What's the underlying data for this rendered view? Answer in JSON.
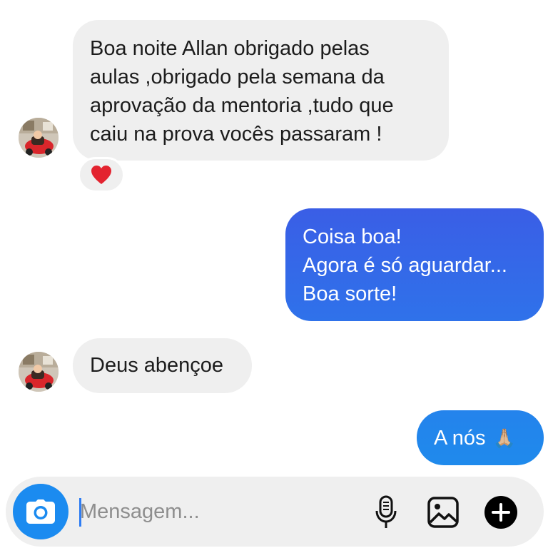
{
  "messages": [
    {
      "direction": "incoming",
      "lines": [
        "Boa noite Allan obrigado pelas",
        "aulas ,obrigado pela semana da",
        "aprovação da mentoria ,tudo que",
        "caiu na prova vocês passaram !"
      ],
      "reaction": "heart"
    },
    {
      "direction": "outgoing",
      "lines": [
        "Coisa boa!",
        "Agora é só aguardar...",
        "Boa sorte!"
      ]
    },
    {
      "direction": "incoming",
      "lines": [
        "Deus abençoe"
      ]
    },
    {
      "direction": "outgoing",
      "text": "A nós",
      "emoji": "🙏🏼"
    }
  ],
  "composer": {
    "placeholder": "Mensagem...",
    "value": "",
    "icons": [
      "camera-icon",
      "microphone-icon",
      "gallery-icon",
      "plus-icon"
    ]
  },
  "colors": {
    "incoming_bubble": "#efefef",
    "outgoing_gradient_start": "#3a5ee6",
    "outgoing_gradient_end": "#1f87ec",
    "camera_button": "#1b8bf0",
    "reaction_heart": "#e3232f"
  }
}
